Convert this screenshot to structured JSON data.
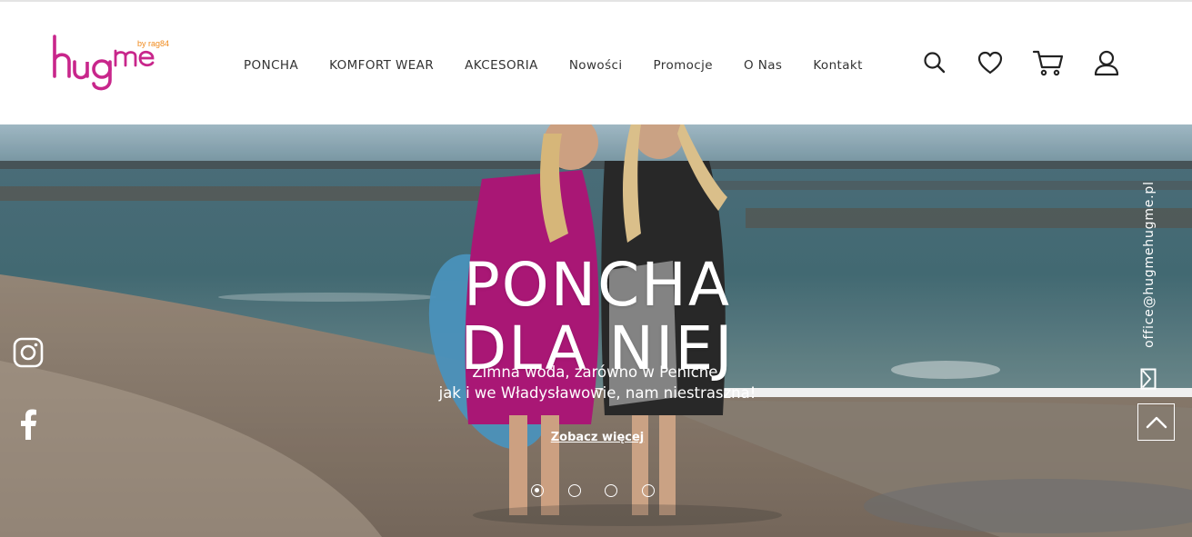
{
  "brand": {
    "name": "hugme",
    "tagline": "by rag84",
    "color_pink": "#c8268b",
    "color_orange": "#f08a1c"
  },
  "nav": {
    "items": [
      {
        "label": "PONCHA"
      },
      {
        "label": "KOMFORT WEAR"
      },
      {
        "label": "AKCESORIA"
      },
      {
        "label": "Nowości"
      },
      {
        "label": "Promocje"
      },
      {
        "label": "O Nas"
      },
      {
        "label": "Kontakt"
      }
    ]
  },
  "header_icons": [
    "search-icon",
    "heart-icon",
    "cart-icon",
    "user-icon"
  ],
  "hero": {
    "title_line1": "PONCHA",
    "title_line2": "DLA NIEJ",
    "subtitle_line1": "Zimna woda, zarówno w Peniche,",
    "subtitle_line2": "jak i we Władysławowie, nam niestraszna!",
    "cta_label": "Zobacz więcej",
    "slide_count": 4,
    "active_slide": 1
  },
  "social": {
    "items": [
      "instagram-icon",
      "facebook-icon"
    ]
  },
  "contact": {
    "email": "office@hugmehugme.pl"
  }
}
